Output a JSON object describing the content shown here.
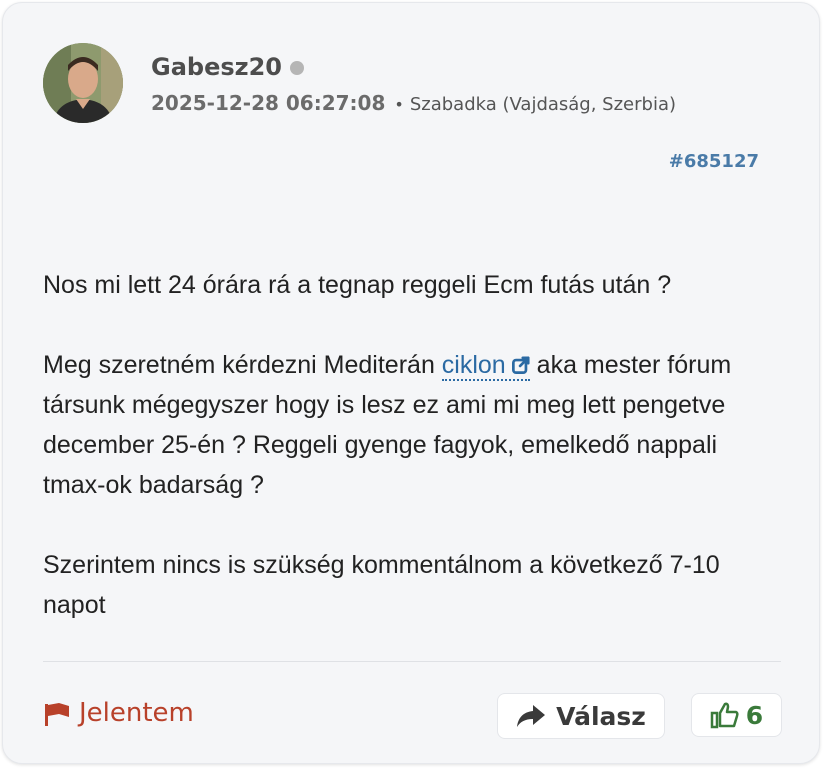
{
  "post": {
    "username": "Gabesz20",
    "timestamp": "2025-12-28 06:27:08",
    "separator": "•",
    "location": "Szabadka (Vajdaság, Szerbia)",
    "post_id": "#685127",
    "online_status_color": "#b5b5b5"
  },
  "content": {
    "p1": "Nos mi lett 24 órára rá a tegnap reggeli Ecm futás után ?",
    "p2_before": "Meg szeretném kérdezni Mediterán ",
    "p2_link": "ciklon",
    "p2_after": " aka mester fórum társunk mégegyszer hogy is lesz ez ami mi meg lett pengetve december 25-én ? Reggeli gyenge fagyok, emelkedő nappali tmax-ok badarság ?",
    "p3": "Szerintem nincs is szükség kommentálnom a következő 7-10 napot"
  },
  "actions": {
    "report_label": "Jelentem",
    "reply_label": "Válasz",
    "like_count": "6"
  },
  "icons": {
    "report": "flag-icon",
    "reply": "share-arrow-icon",
    "like": "thumbs-up-icon",
    "external": "external-link-icon"
  },
  "colors": {
    "link": "#2b6aa3",
    "post_id": "#4a7ba8",
    "report": "#b8412a",
    "like": "#3a7a3a"
  }
}
